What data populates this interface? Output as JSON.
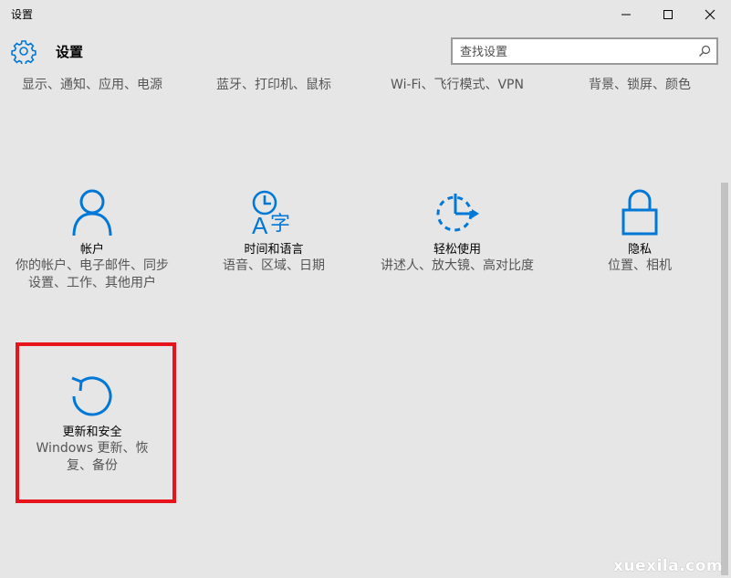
{
  "window": {
    "title": "设置"
  },
  "header": {
    "app_title": "设置"
  },
  "search": {
    "placeholder": "查找设置"
  },
  "top_row": [
    {
      "desc": "显示、通知、应用、电源"
    },
    {
      "desc": "蓝牙、打印机、鼠标"
    },
    {
      "desc": "Wi-Fi、飞行模式、VPN"
    },
    {
      "desc": "背景、锁屏、颜色"
    }
  ],
  "tiles": [
    {
      "name": "帐户",
      "desc": "你的帐户、电子邮件、同步设置、工作、其他用户",
      "icon": "person-icon"
    },
    {
      "name": "时间和语言",
      "desc": "语音、区域、日期",
      "icon": "time-language-icon"
    },
    {
      "name": "轻松使用",
      "desc": "讲述人、放大镜、高对比度",
      "icon": "ease-of-access-icon"
    },
    {
      "name": "隐私",
      "desc": "位置、相机",
      "icon": "lock-icon"
    },
    {
      "name": "更新和安全",
      "desc": "Windows 更新、恢复、备份",
      "icon": "update-icon"
    }
  ],
  "colors": {
    "accent": "#0078d7",
    "highlight": "#e8141b",
    "background": "#e6e6e6"
  },
  "watermark": "xuexila.com"
}
